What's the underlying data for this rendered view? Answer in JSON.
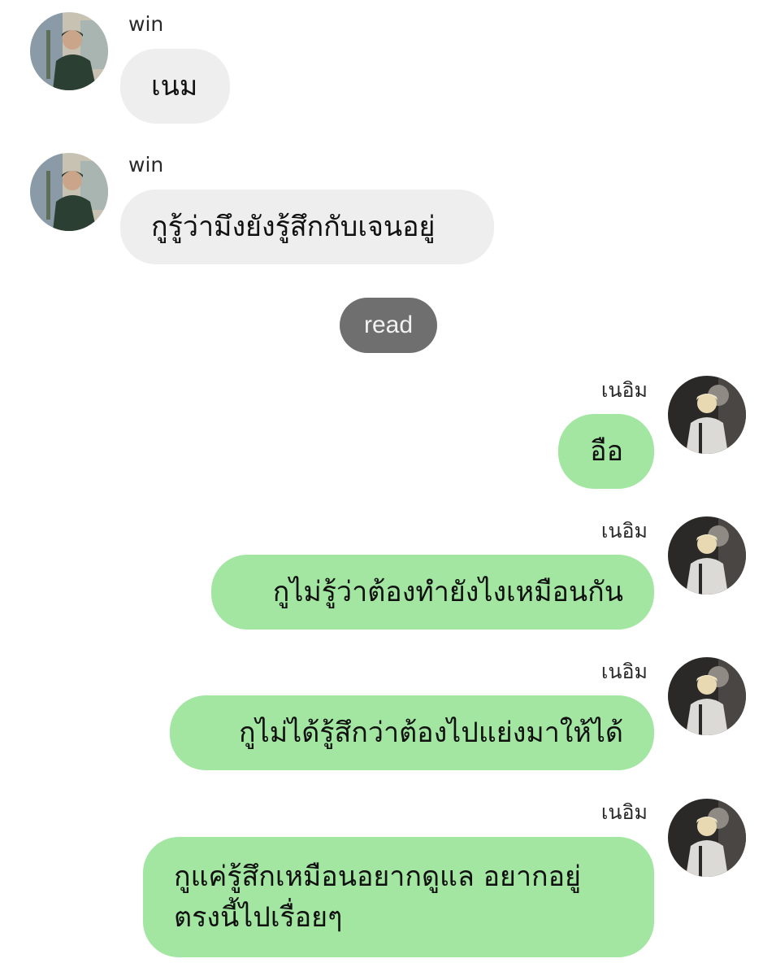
{
  "chat": {
    "messages": [
      {
        "sender": "win",
        "direction": "incoming",
        "avatar": "win-avatar",
        "text": "เนม"
      },
      {
        "sender": "win",
        "direction": "incoming",
        "avatar": "win-avatar",
        "text": "กูรู้ว่ามึงยังรู้สึกกับเจนอยู่"
      },
      {
        "sender": "เนอิม",
        "direction": "outgoing",
        "avatar": "neim-avatar",
        "text": "อือ"
      },
      {
        "sender": "เนอิม",
        "direction": "outgoing",
        "avatar": "neim-avatar",
        "text": "กูไม่รู้ว่าต้องทำยังไงเหมือนกัน"
      },
      {
        "sender": "เนอิม",
        "direction": "outgoing",
        "avatar": "neim-avatar",
        "text": "กูไม่ได้รู้สึกว่าต้องไปแย่งมาให้ได้"
      },
      {
        "sender": "เนอิม",
        "direction": "outgoing",
        "avatar": "neim-avatar",
        "lines": [
          "กูแค่รู้สึกเหมือนอยากดูแล อยากอยู่",
          "ตรงนี้ไปเรื่อยๆ"
        ]
      }
    ],
    "read_label": "read"
  },
  "colors": {
    "incoming_bubble": "#eeeeee",
    "outgoing_bubble": "#a2e6a1",
    "read_pill": "#6f6f6f",
    "background": "#ffffff"
  }
}
